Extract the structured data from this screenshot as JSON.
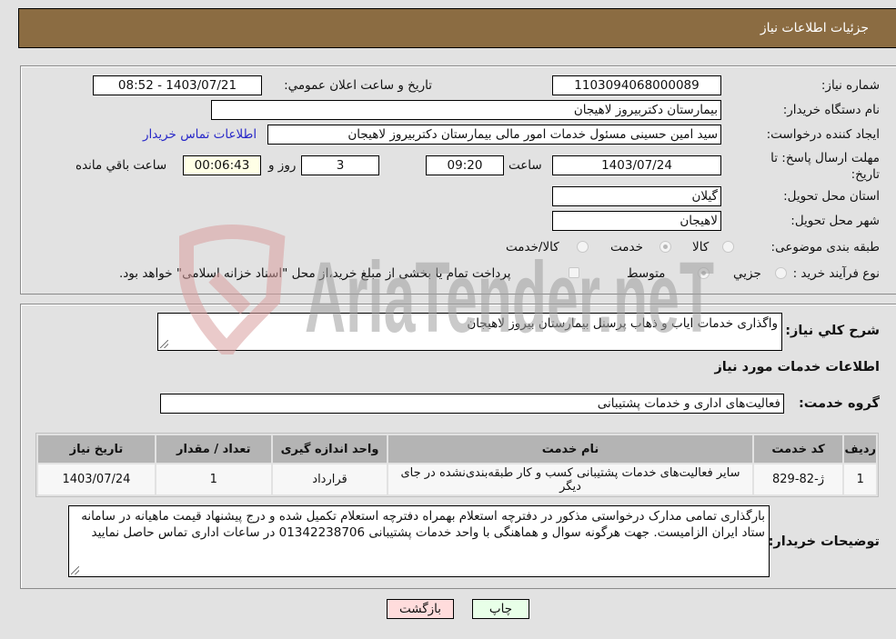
{
  "header": {
    "title": "جزئیات اطلاعات نیاز"
  },
  "form": {
    "need_number": {
      "label": "شماره نیاز:",
      "value": "1103094068000089"
    },
    "announce_datetime": {
      "label": "تاریخ و ساعت اعلان عمومي:",
      "value": "1403/07/21 - 08:52"
    },
    "buyer_org": {
      "label": "نام دستگاه خریدار:",
      "value": "بیمارستان دکتربیروز لاهیجان"
    },
    "requester": {
      "label": "ایجاد کننده درخواست:",
      "value": "سید امین حسینی مسئول خدمات امور مالی بیمارستان دکتربیروز لاهیجان"
    },
    "buyer_contact_link": "اطلاعات تماس خریدار",
    "deadline": {
      "label": "مهلت ارسال پاسخ: تا تاریخ:",
      "date": "1403/07/24",
      "time_label": "ساعت",
      "time": "09:20",
      "days": "3",
      "days_label": "روز و",
      "remaining": "00:06:43",
      "remaining_label": "ساعت باقي مانده"
    },
    "province": {
      "label": "استان محل تحویل:",
      "value": "گیلان"
    },
    "city": {
      "label": "شهر محل تحویل:",
      "value": "لاهیجان"
    },
    "category": {
      "label": "طبقه بندی موضوعی:",
      "options": [
        "کالا",
        "خدمت",
        "کالا/خدمت"
      ],
      "selected": "خدمت"
    },
    "purchase_type": {
      "label": "نوع فرآیند خرید :",
      "options": [
        "جزیي",
        "متوسط"
      ],
      "selected": "متوسط",
      "treasury_checkbox_label": "پرداخت تمام یا بخشی از مبلغ خرید،از محل \"اسناد خزانه اسلامی\" خواهد بود.",
      "treasury_checked": false
    }
  },
  "details": {
    "summary_label": "شرح کلي نیاز:",
    "summary_value": "واگذاری خدمات ایاب و ذهاب پرسنل بیمارستان بیروز لاهیجان",
    "services_heading": "اطلاعات خدمات مورد نیاز",
    "service_group_label": "گروه خدمت:",
    "service_group_value": "فعالیت‌های اداری و خدمات پشتیبانی",
    "table": {
      "headers": [
        "ردیف",
        "کد خدمت",
        "نام خدمت",
        "واحد اندازه گیری",
        "تعداد / مقدار",
        "تاریخ نیاز"
      ],
      "rows": [
        [
          "1",
          "ژ-82-829",
          "سایر فعالیت‌های خدمات پشتیبانی کسب و کار طبقه‌بندی‌نشده در جای دیگر",
          "قرارداد",
          "1",
          "1403/07/24"
        ]
      ]
    },
    "buyer_notes_label": "توضیحات خریدار:",
    "buyer_notes_value": "بارگذاری تمامی مدارک درخواستی مذکور در دفترچه استعلام بهمراه دفترچه استعلام تکمیل شده  و درج پیشنهاد قیمت ماهیانه در سامانه ستاد ایران الزامیست. جهت هرگونه سوال و هماهنگی با واحد خدمات پشتیبانی 01342238706 در ساعات اداری تماس حاصل نمایید"
  },
  "buttons": {
    "print": "چاپ",
    "back": "بازگشت"
  },
  "watermark": {
    "text": "AriaTender.neT",
    "logo_color": "#d9a0a0",
    "text_color": "#a0a0a0"
  },
  "colors": {
    "header_bg": "#8b6c42",
    "link": "#2828c8",
    "remaining_bg": "#ffffe6",
    "back_bg": "#ffdcdc",
    "print_bg": "#e8ffe8"
  }
}
